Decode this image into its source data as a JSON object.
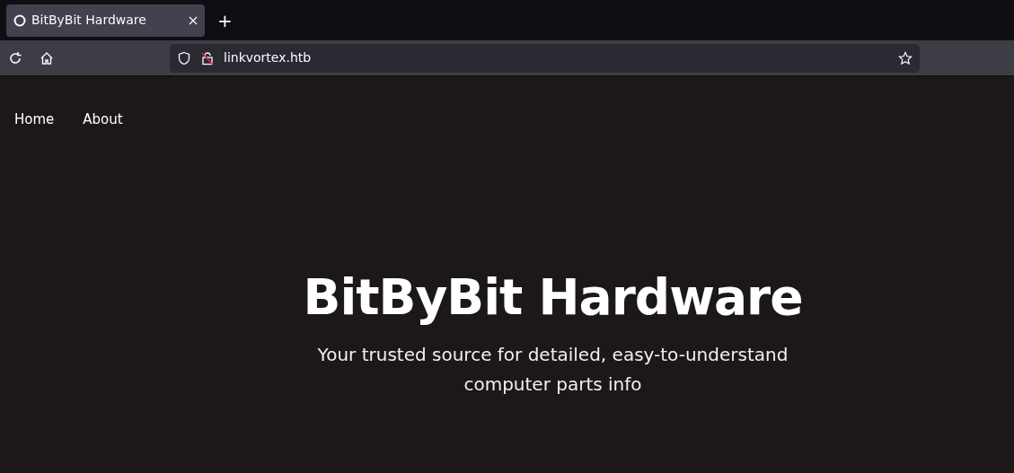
{
  "browser": {
    "tabs": [
      {
        "title": "BitByBit Hardware",
        "selected": true
      }
    ],
    "new_tab": "+",
    "url": "linkvortex.htb"
  },
  "nav": [
    {
      "label": "Home"
    },
    {
      "label": "About"
    }
  ],
  "hero": {
    "title": "BitByBit Hardware",
    "subtitle": "Your trusted source for detailed, easy-to-understand computer parts info"
  }
}
